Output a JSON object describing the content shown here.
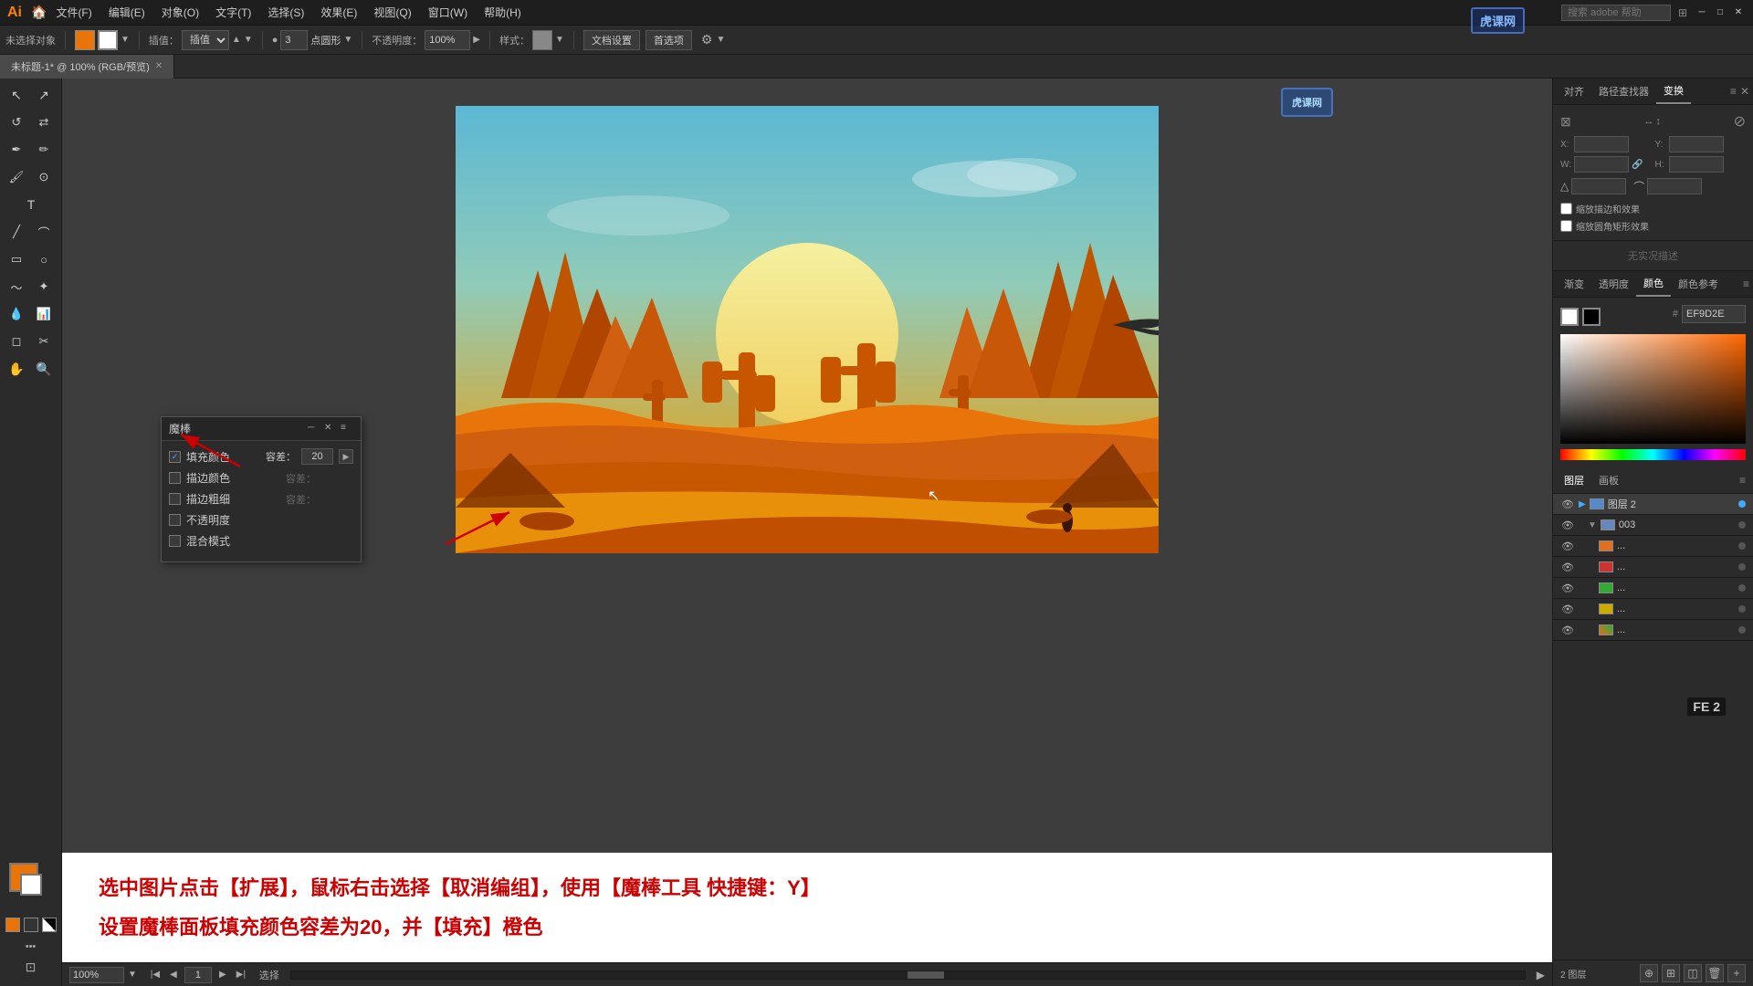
{
  "app": {
    "logo": "Ai",
    "title": "Adobe Illustrator"
  },
  "menu": {
    "items": [
      "文件(F)",
      "编辑(E)",
      "对象(O)",
      "文字(T)",
      "选择(S)",
      "效果(E)",
      "视图(Q)",
      "窗口(W)",
      "帮助(H)"
    ]
  },
  "toolbar": {
    "stroke_label": "描边：",
    "blend_label": "插值：",
    "point_count": "3",
    "shape_label": "点圆形",
    "opacity_label": "不透明度：",
    "opacity_value": "100%",
    "style_label": "样式：",
    "doc_settings": "文档设置",
    "prefs": "首选项"
  },
  "tabs": [
    {
      "label": "未标题-1* @ 100% (RGB/预览)",
      "active": true
    }
  ],
  "magic_panel": {
    "title": "魔棒",
    "fill_color": "填充颜色",
    "fill_color_checked": true,
    "fill_tolerance_label": "容差：",
    "fill_tolerance_value": "20",
    "stroke_color": "描边颜色",
    "stroke_color_checked": false,
    "stroke_tolerance_label": "容差：",
    "stroke_tolerance_value": "",
    "stroke_weight": "描边粗细",
    "stroke_weight_checked": false,
    "stroke_weight_label": "容差：",
    "opacity": "不透明度",
    "opacity_checked": false,
    "blend_mode": "混合模式",
    "blend_mode_checked": false
  },
  "instructions": {
    "line1": "选中图片点击【扩展】，鼠标右击选择【取消编组】，使用【魔棒工具 快捷键：Y】",
    "line2": "设置魔棒面板填充颜色容差为20，并【填充】橙色"
  },
  "right_panel": {
    "top_tabs": [
      "对齐",
      "路径查找器",
      "变换"
    ],
    "active_tab": "变换",
    "transform": {
      "x_label": "X：",
      "y_label": "Y：",
      "w_label": "W：",
      "h_label": "H："
    },
    "color_section": {
      "tabs": [
        "渐变",
        "透明度",
        "颜色",
        "颜色参考"
      ],
      "active_tab": "颜色",
      "hex_prefix": "#",
      "hex_value": "EF9D2E"
    },
    "layers_section": {
      "tabs": [
        "图层",
        "画板"
      ],
      "active_tab": "图层",
      "layers": [
        {
          "name": "图层 2",
          "type": "group",
          "active": true,
          "visible": true,
          "expanded": true
        },
        {
          "name": "003",
          "type": "group",
          "active": false,
          "visible": true,
          "sub": true
        },
        {
          "name": "...",
          "type": "orange",
          "active": false,
          "visible": true,
          "sub": true
        },
        {
          "name": "...",
          "type": "red",
          "active": false,
          "visible": true,
          "sub": true
        },
        {
          "name": "...",
          "type": "green",
          "active": false,
          "visible": true,
          "sub": true
        },
        {
          "name": "...",
          "type": "yellow",
          "active": false,
          "visible": true,
          "sub": true
        },
        {
          "name": "...",
          "type": "multi",
          "active": false,
          "visible": true,
          "sub": true
        }
      ],
      "bottom_label": "2 图层"
    }
  },
  "status_bar": {
    "zoom": "100%",
    "page": "1",
    "action_label": "选择"
  },
  "watermark": {
    "text": "虎课网"
  },
  "canvas": {
    "background_sky_top": "#5bb8d4",
    "background_sky_bottom": "#e8b840",
    "sun_color": "#f5f0a0",
    "ground_color": "#e8740a"
  }
}
